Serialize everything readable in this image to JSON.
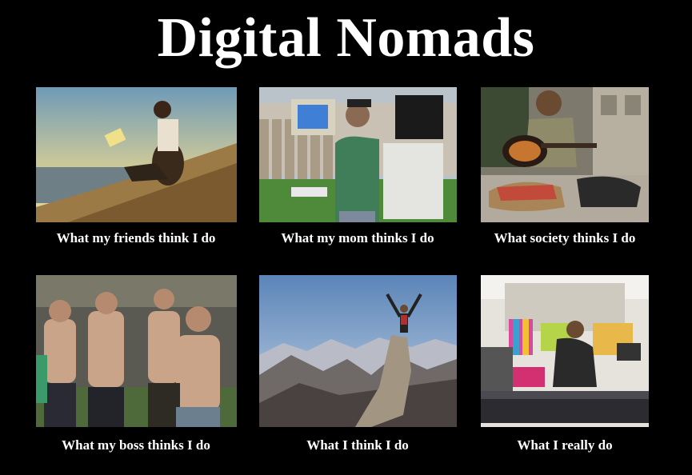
{
  "title": "Digital Nomads",
  "panels": [
    {
      "caption": "What my friends think I do"
    },
    {
      "caption": "What my mom thinks I do"
    },
    {
      "caption": "What society thinks I do"
    },
    {
      "caption": "What my boss thinks I do"
    },
    {
      "caption": "What I think I do"
    },
    {
      "caption": "What I really do"
    }
  ]
}
